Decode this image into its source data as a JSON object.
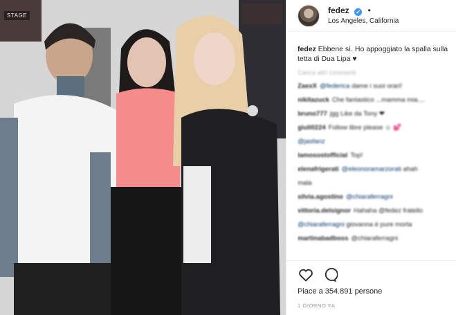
{
  "photo": {
    "alt_label": "STAGE"
  },
  "header": {
    "username": "fedez",
    "verified_mark": "✔",
    "separator": "•",
    "location": "Los Angeles, California"
  },
  "caption": {
    "username": "fedez",
    "text": "Ebbene sì. Ho appoggiato la spalla sulla tetta di Dua Lipa ♥"
  },
  "load_more": "Carica altri commenti",
  "comments": [
    {
      "user": "ZaexX",
      "mention": "@federica",
      "text": "dame i suoi orari!"
    },
    {
      "user": "nikitazuck",
      "mention": "",
      "text": "Che fantastico ...mamma mia...."
    },
    {
      "user": "bruno777",
      "mention": "",
      "text": "jgg Like da Tony ❤"
    },
    {
      "user": "giuli0224",
      "mention": "",
      "text": "Follow libre please ☺ 💕"
    },
    {
      "user": "",
      "mention": "@jasfanz",
      "text": ""
    },
    {
      "user": "lamosostofficial",
      "mention": "",
      "text": "Top!"
    },
    {
      "user": "elenafrigerati",
      "mention": "@eleonoramarzorati",
      "text": "ahah"
    },
    {
      "user": "",
      "mention": "",
      "text": "mala"
    },
    {
      "user": "silvia.agostino",
      "mention": "@chiaraferragni",
      "text": ""
    },
    {
      "user": "vittoria.delsignor",
      "mention": "",
      "text": "Hahaha @fedez fratello"
    },
    {
      "user": "",
      "mention": "@chiaraferragni",
      "text": "giovanna è pure morta"
    },
    {
      "user": "martinabadboss",
      "mention": "",
      "text": "@chiaraferragni"
    }
  ],
  "actions": {
    "like_icon": "heart-outline-icon",
    "comment_icon": "comment-bubble-icon",
    "likes_text": "Piace a 354.891 persone",
    "time_ago": "1 GIORNO FA"
  },
  "colors": {
    "link": "#003569",
    "verified": "#3897f0",
    "muted": "#999999"
  }
}
